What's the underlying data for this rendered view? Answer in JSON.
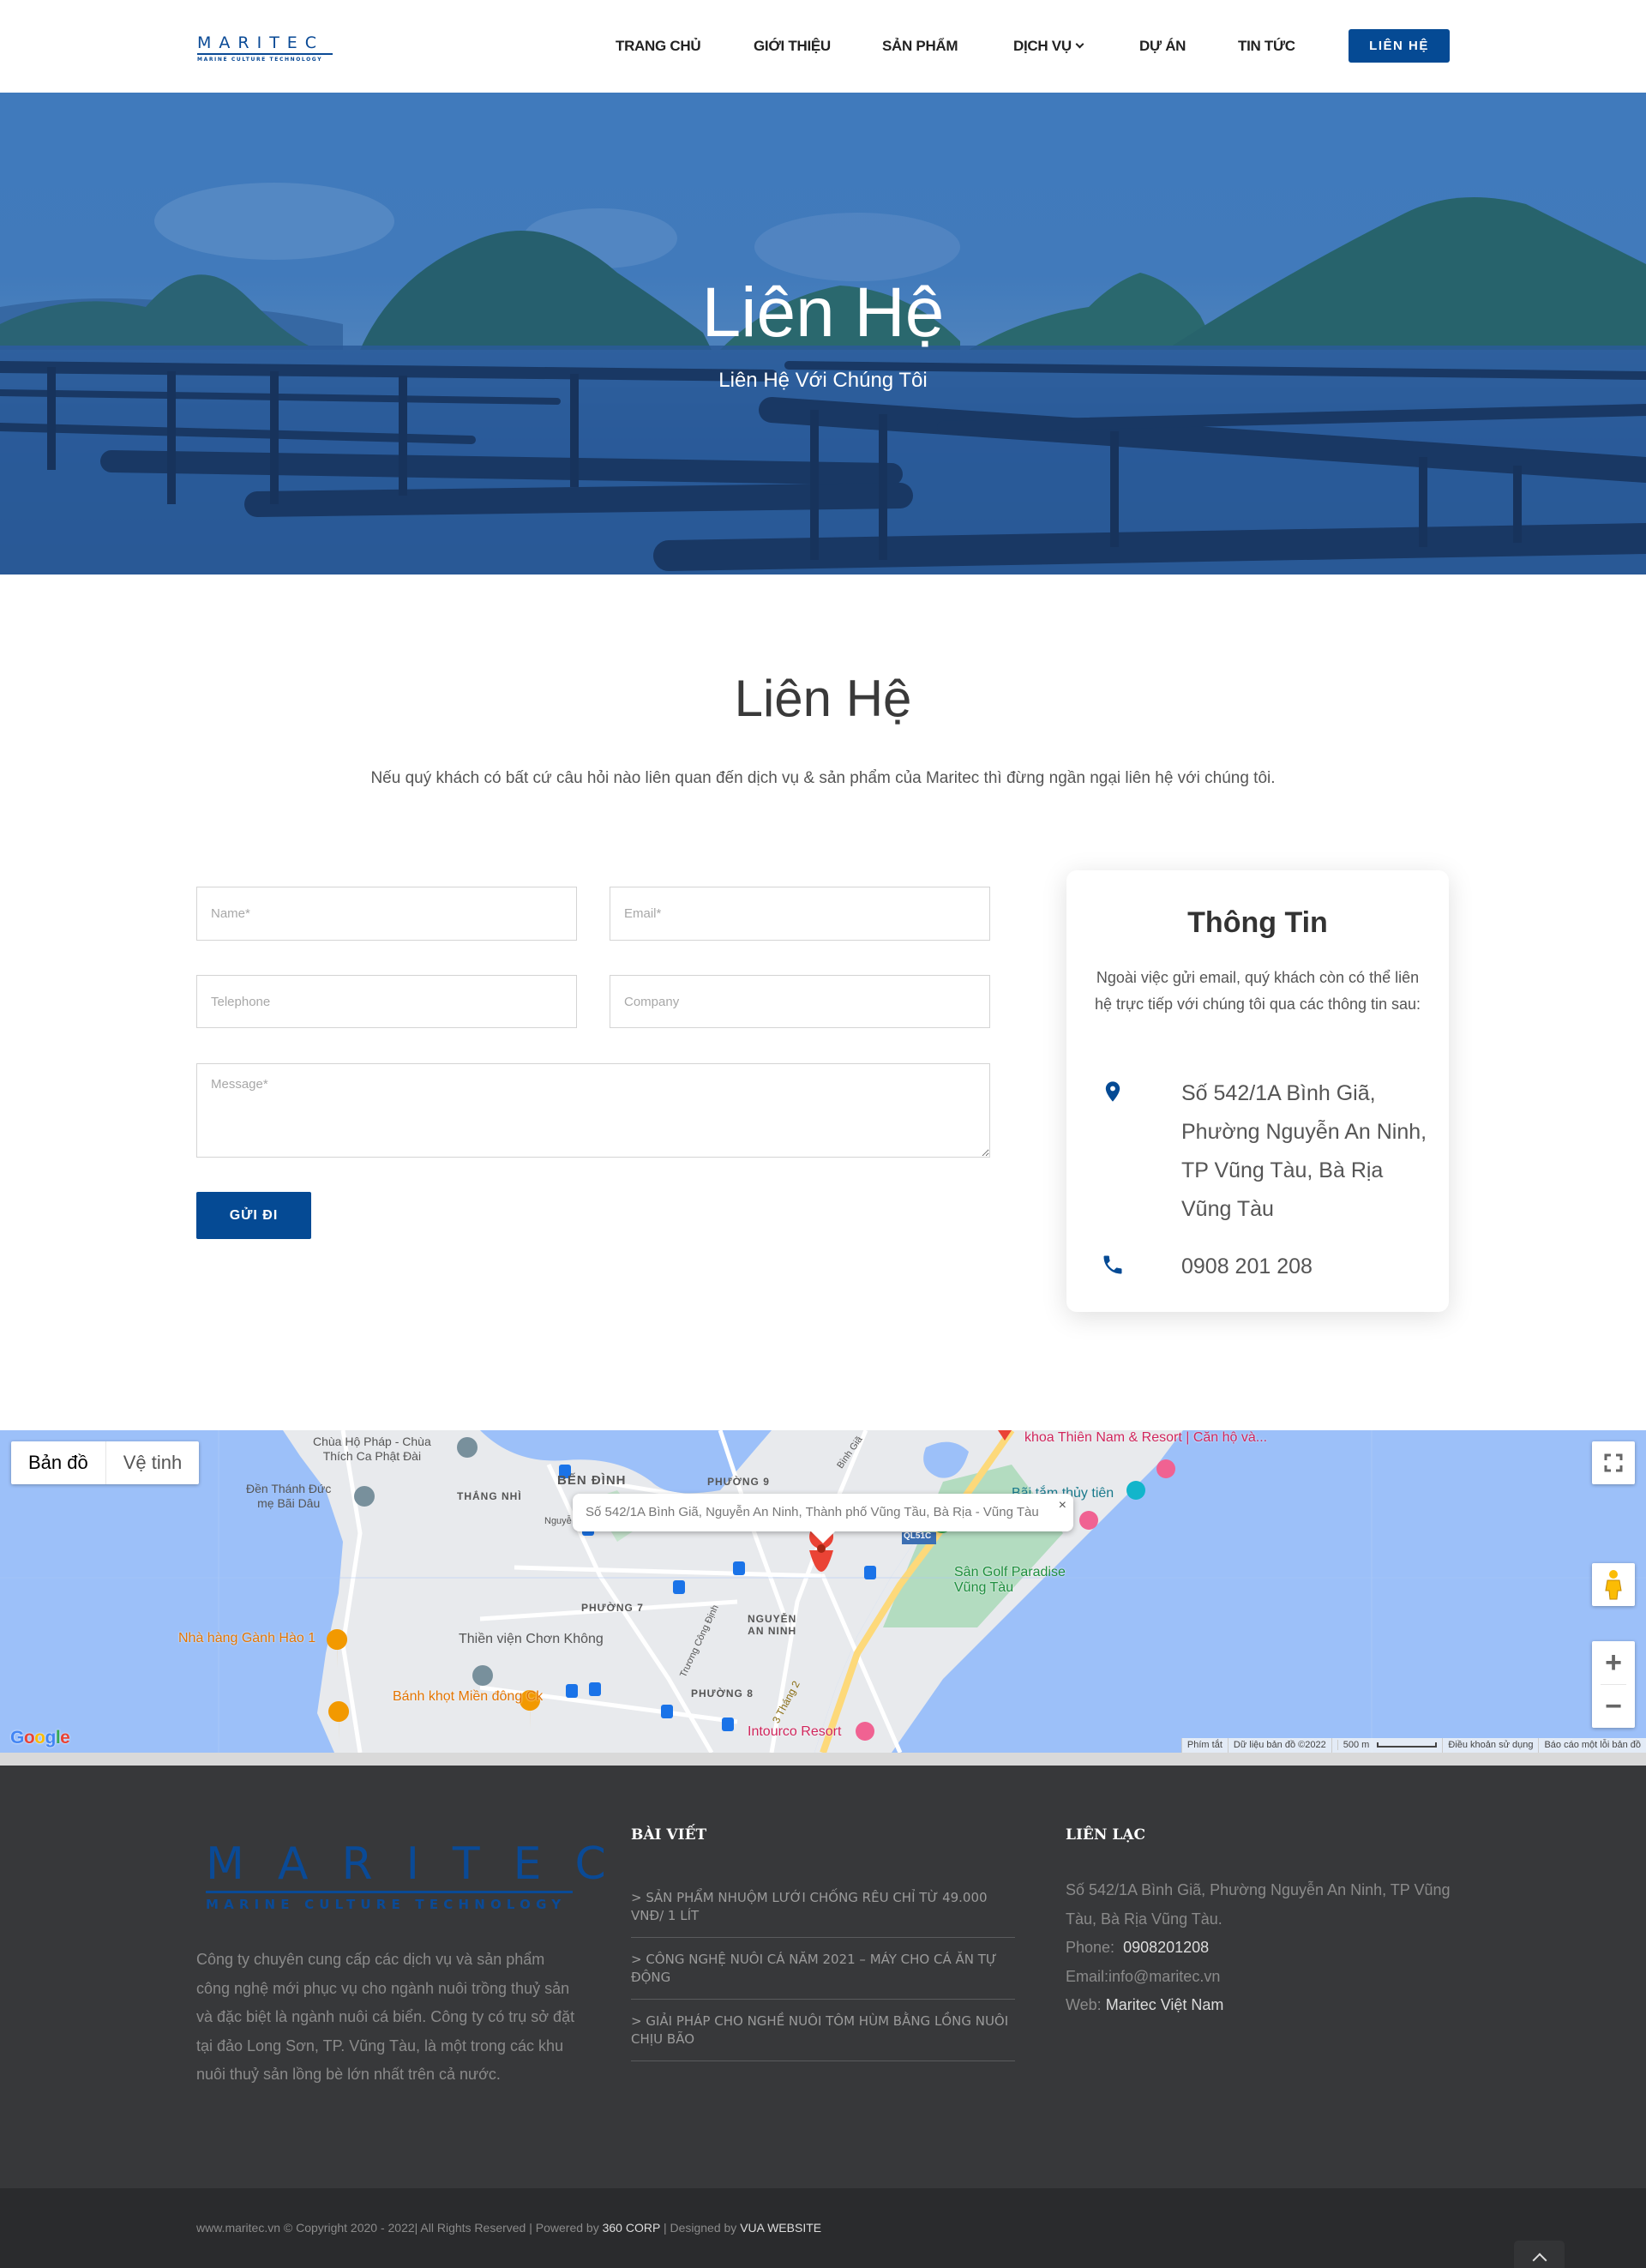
{
  "header": {
    "logo_word": "MARITEC",
    "logo_tagline": "MARINE CULTURE TECHNOLOGY",
    "nav": [
      {
        "label": "TRANG CHỦ"
      },
      {
        "label": "GIỚI THIỆU"
      },
      {
        "label": "SẢN PHẨM"
      },
      {
        "label": "DỊCH VỤ",
        "has_dropdown": true
      },
      {
        "label": "DỰ ÁN"
      },
      {
        "label": "TIN TỨC"
      }
    ],
    "cta_label": "LIÊN HỆ"
  },
  "hero": {
    "title": "Liên Hệ",
    "subtitle": "Liên Hệ Với Chúng Tôi"
  },
  "contact": {
    "title": "Liên Hệ",
    "intro": "Nếu quý khách có bất cứ câu hỏi nào liên quan đến dịch vụ & sản phẩm của Maritec thì đừng ngần ngại liên hệ với chúng tôi.",
    "form": {
      "name_placeholder": "Name*",
      "name_value": "",
      "email_placeholder": "Email*",
      "email_value": "",
      "telephone_placeholder": "Telephone",
      "telephone_value": "",
      "company_placeholder": "Company",
      "company_value": "",
      "message_placeholder": "Message*",
      "message_value": "",
      "submit_label": "GỬI ĐI"
    },
    "info_card": {
      "title": "Thông Tin",
      "description": "Ngoài việc gửi email, quý khách còn có thể liên hệ trực tiếp với chúng tôi qua các thông tin sau:",
      "address_icon": "map-marker-icon",
      "address": "Số 542/1A Bình Giã, Phường Nguyễn An Ninh, TP Vũng Tàu, Bà Rịa Vũng Tàu",
      "phone_icon": "phone-icon",
      "phone": "0908 201 208"
    }
  },
  "map": {
    "type_buttons": [
      {
        "label": "Bản đồ",
        "active": true
      },
      {
        "label": "Vệ tinh",
        "active": false
      }
    ],
    "popup_text": "Số 542/1A Bình Giã, Nguyễn An Ninh, Thành phố Vũng Tầu, Bà Rịa - Vũng Tàu",
    "popup_close": "×",
    "labels": {
      "chua_ho_phap": "Chùa Hộ Pháp - Chùa",
      "chua_ho_phap_2": "Thích Ca Phật Đài",
      "den_thanh": "Đền Thánh Đức",
      "den_thanh_2": "mẹ Bãi Dâu",
      "thang_nhi": "THẮNG NHÌ",
      "ben_dinh": "BẾN ĐÌNH",
      "phuong_9": "PHƯỜNG 9",
      "phuong_7": "PHƯỜNG 7",
      "phuong_8": "PHƯỜNG 8",
      "nguyen_an_ninh": "NGUYỄN",
      "nguyen_an_ninh_2": "AN NINH",
      "nha_hang": "Nhà hàng Gành Hào 1",
      "thien_vien": "Thiền viện Chơn Không",
      "banh_khot": "Bánh khọt Miền đông Ck",
      "golf": "Sân Golf Paradise",
      "golf_2": "Vũng Tàu",
      "intourco": "Intourco Resort",
      "thien_nam": "khoa Thiên Nam & Resort | Căn hộ và...",
      "bai_tam": "Bãi tắm thủy tiên",
      "ql51c": "QL51C",
      "truong_cong_dinh": "Trương Công Định",
      "thang_2": "3 Tháng 2",
      "binh_gia": "Bình Giã",
      "nguyen": "Nguyễ"
    },
    "attribution": [
      "Phím tắt",
      "Dữ liệu bản đồ ©2022",
      "500 m",
      "Điều khoản sử dụng",
      "Báo cáo một lỗi bản đồ"
    ],
    "google_logo": "Google",
    "colors": {
      "water": "#9cc0f9",
      "land": "#e8eaed",
      "park": "#b3dcc0",
      "highway": "#fdd97a",
      "pin": "#ea4335"
    }
  },
  "footer": {
    "logo_word": "MARITEC",
    "logo_tagline": "MARINE CULTURE TECHNOLOGY",
    "about": "Công ty chuyên cung cấp các dịch vụ và sản phẩm công nghệ mới phục vụ cho ngành nuôi trồng thuỷ sản và đặc biệt là ngành nuôi cá biển. Công ty có trụ sở đặt tại đảo Long Sơn, TP. Vũng Tàu, là một trong các khu nuôi thuỷ sản lồng bè lớn nhất trên cả nước.",
    "posts_heading": "BÀI VIẾT",
    "posts": [
      {
        "title": "> SẢN PHẨM NHUỘM LƯỚI CHỐNG RÊU CHỈ TỪ 49.000 VNĐ/ 1 LÍT"
      },
      {
        "title": "> CÔNG NGHỆ NUÔI CÁ NĂM 2021 – MÁY CHO CÁ ĂN TỰ ĐỘNG"
      },
      {
        "title": "> GIẢI PHÁP CHO NGHỀ NUÔI TÔM HÙM BẰNG LỒNG NUÔI CHỊU BÃO"
      }
    ],
    "contact_heading": "LIÊN LẠC",
    "contact_address": "Số 542/1A Bình Giã, Phường Nguyễn An Ninh, TP Vũng Tàu, Bà Rịa Vũng Tàu.",
    "phone_label": "Phone:",
    "phone_value": "0908201208",
    "email_label": "Email:",
    "email_value": "info@maritec.vn",
    "web_label": "Web:",
    "web_value": "Maritec Việt Nam",
    "copyright_prefix": "www.maritec.vn © Copyright 2020 - 2022| All Rights Reserved | Powered by",
    "powered_by": "360 CORP",
    "designed_prefix": "| Designed by",
    "designed_by": "VUA WEBSITE"
  },
  "colors": {
    "brand": "#054a94",
    "footer_bg": "#37383a",
    "bottom_bar_bg": "#2a2b2d"
  }
}
